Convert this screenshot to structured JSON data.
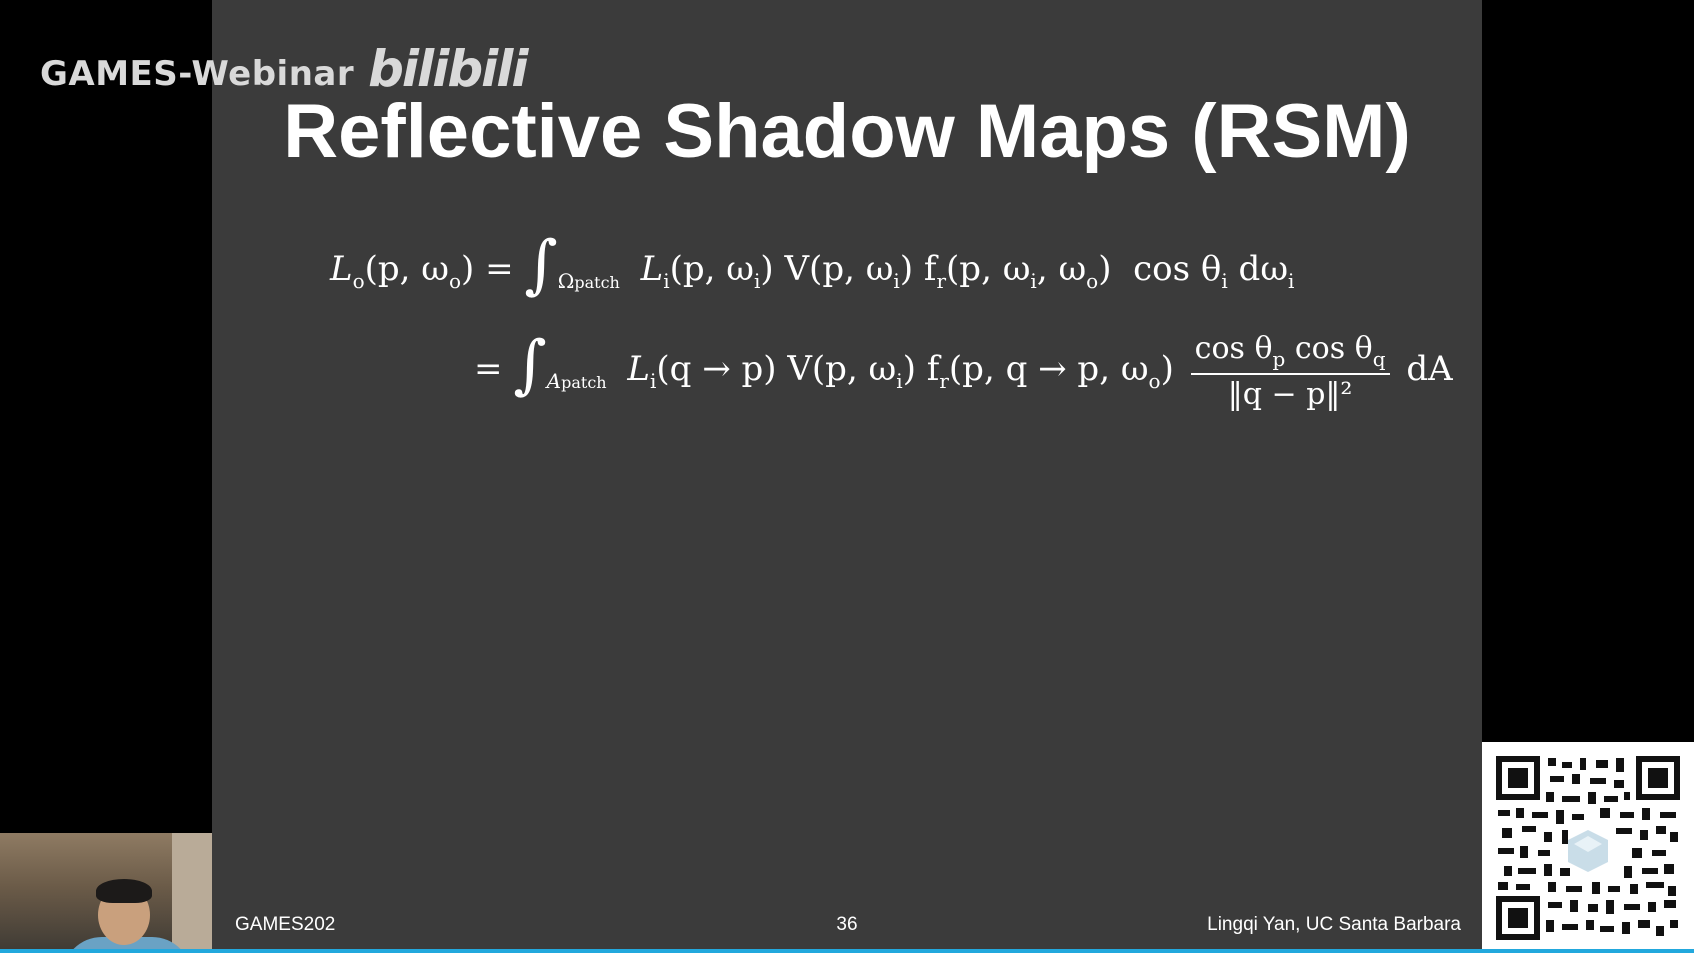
{
  "watermark": {
    "text": "GAMES-Webinar",
    "logo": "bilibili"
  },
  "slide": {
    "title": "Reflective Shadow Maps (RSM)",
    "eq1": {
      "lhs": "L",
      "lhs_sub": "o",
      "lhs_args": "(p, ω",
      "lhs_args_sub": "o",
      "lhs_close": ") =",
      "integral_sub": "Ω",
      "integral_sub2": "patch",
      "body": "L",
      "body_sub": "i",
      "body_rest": "(p, ω",
      "body_rest_sub": "i",
      "body_rest2": ") V(p, ω",
      "body_rest2_sub": "i",
      "body_rest3": ") f",
      "body_rest3_sub": "r",
      "body_rest4": "(p, ω",
      "body_rest4_sub": "i",
      "body_rest5": ", ω",
      "body_rest5_sub": "o",
      "body_rest6": ")  cos θ",
      "body_rest6_sub": "i",
      "body_rest7": " dω",
      "body_rest7_sub": "i"
    },
    "eq2": {
      "eq": "=",
      "integral_sub": "A",
      "integral_sub2": "patch",
      "body": "L",
      "body_sub": "i",
      "body_rest": "(q → p) V(p, ω",
      "body_rest_sub": "i",
      "body_rest2": ") f",
      "body_rest2_sub": "r",
      "body_rest3": "(p, q → p, ω",
      "body_rest3_sub": "o",
      "body_rest4": ")",
      "frac_num_a": "cos θ",
      "frac_num_a_sub": "p",
      "frac_num_b": " cos θ",
      "frac_num_b_sub": "q",
      "frac_den": "‖q − p‖²",
      "tail": "dA"
    },
    "footer_left": "GAMES202",
    "footer_center": "36",
    "footer_right": "Lingqi Yan, UC Santa Barbara"
  },
  "overlay": {
    "webcam_icon": "presenter-webcam",
    "qr_icon": "qr-code-icon"
  }
}
